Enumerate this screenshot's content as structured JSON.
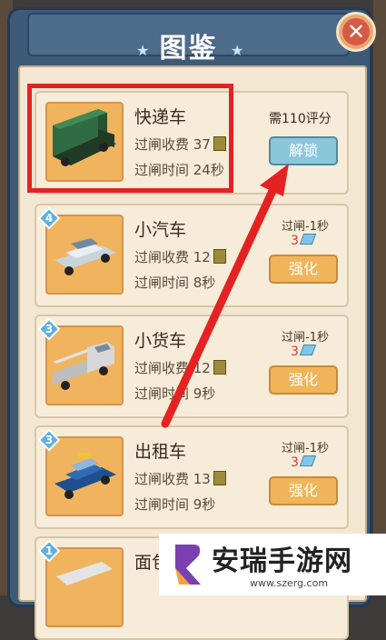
{
  "header": {
    "title": "图鉴",
    "close_icon": "close-icon"
  },
  "vehicles": [
    {
      "name": "快递车",
      "toll": "过闸收费 37",
      "time": "过闸时间 24秒",
      "requirement": "需110评分",
      "button": "解锁",
      "color": "#2f6b43"
    },
    {
      "level": "4",
      "name": "小汽车",
      "toll": "过闸收费 12",
      "time": "过闸时间 8秒",
      "bonus": "过闸-1秒",
      "cost": "3",
      "button": "强化",
      "color": "#e8eef4"
    },
    {
      "level": "3",
      "name": "小货车",
      "toll": "过闸收费 12",
      "time": "过闸时间 9秒",
      "bonus": "过闸-1秒",
      "cost": "3",
      "button": "强化",
      "color": "#d8d8d8"
    },
    {
      "level": "3",
      "name": "出租车",
      "toll": "过闸收费 13",
      "time": "过闸时间 9秒",
      "bonus": "过闸-1秒",
      "cost": "3",
      "button": "强化",
      "color": "#2f6bb5"
    },
    {
      "level": "1",
      "name": "面包车"
    }
  ],
  "watermark": {
    "text": "安瑞手游网",
    "url": "www.szerg.com"
  }
}
